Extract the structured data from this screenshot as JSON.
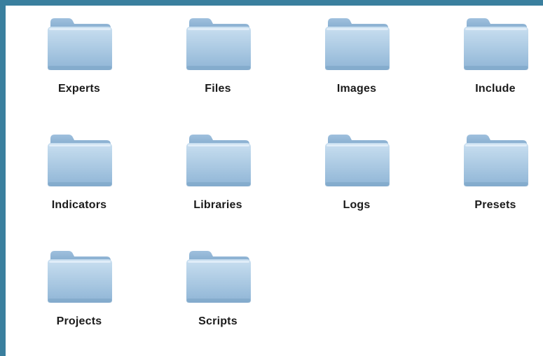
{
  "finder": {
    "folders": [
      {
        "label": "Experts"
      },
      {
        "label": "Files"
      },
      {
        "label": "Images"
      },
      {
        "label": "Include"
      },
      {
        "label": "Indicators"
      },
      {
        "label": "Libraries"
      },
      {
        "label": "Logs"
      },
      {
        "label": "Presets"
      },
      {
        "label": "Projects"
      },
      {
        "label": "Scripts"
      }
    ],
    "icon": "folder-icon",
    "colors": {
      "background": "#3a7f9e",
      "window": "#ffffff",
      "folder_light": "#c9dff0",
      "folder_dark": "#8fb5d6",
      "label": "#1b1b1b"
    }
  }
}
